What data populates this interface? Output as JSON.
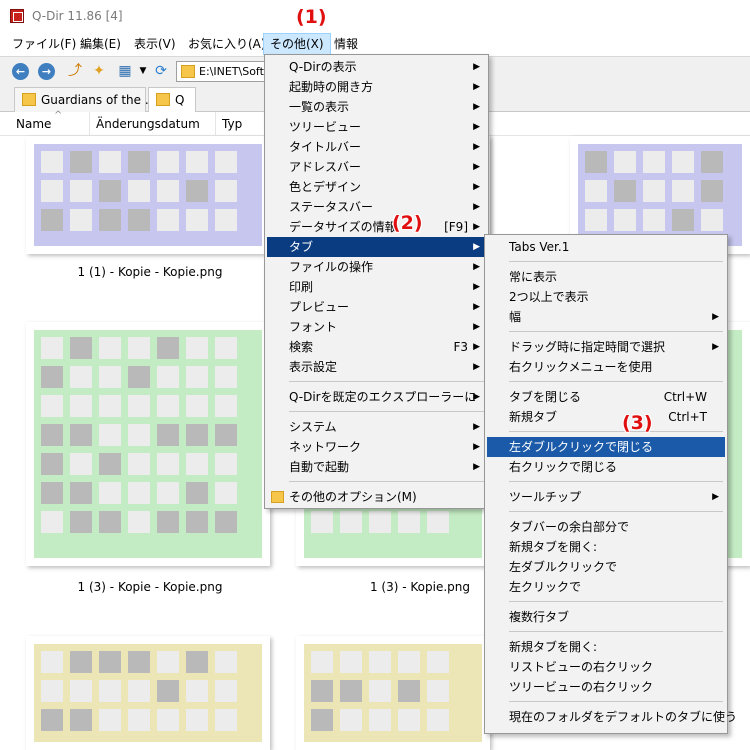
{
  "window": {
    "title": "Q-Dir 11.86 [4]"
  },
  "menubar": {
    "items": [
      "ファイル(F)",
      "編集(E)",
      "表示(V)",
      "お気に入り(A)",
      "その他(X)",
      "情報"
    ]
  },
  "toolbar": {
    "address": "E:\\INET\\Soft"
  },
  "tabs": [
    {
      "label": "Guardians of the ..."
    },
    {
      "label": "Q"
    }
  ],
  "columns": [
    "Name",
    "Änderungsdatum",
    "Typ"
  ],
  "thumbnails": [
    {
      "caption": "1 (1) - Kopie - Kopie.png"
    },
    {
      "caption": "1 (3) - Kopie - Kopie.png"
    },
    {
      "caption": "1 (3) - Kopie.png"
    }
  ],
  "colors": {
    "blue_tile": "#c6c6ee",
    "green_tile": "#c4ecc4",
    "yellow_tile": "#ece6b6",
    "gray_cell": "#b9b9b9",
    "light_cell": "#ececec",
    "menu_highlight": "#0a3c82"
  },
  "other_menu": {
    "items": [
      {
        "label": "Q-Dirの表示",
        "arrow": true
      },
      {
        "label": "起動時の開き方",
        "arrow": true
      },
      {
        "label": "一覧の表示",
        "arrow": true
      },
      {
        "label": "ツリービュー",
        "arrow": true
      },
      {
        "label": "タイトルバー",
        "arrow": true
      },
      {
        "label": "アドレスバー",
        "arrow": true
      },
      {
        "label": "色とデザイン",
        "arrow": true
      },
      {
        "label": "ステータスバー",
        "arrow": true
      },
      {
        "label": "データサイズの情報",
        "shortcut": "[F9]",
        "arrow": true
      },
      {
        "label": "タブ",
        "arrow": true,
        "highlight": true
      },
      {
        "label": "ファイルの操作",
        "arrow": true
      },
      {
        "label": "印刷",
        "arrow": true
      },
      {
        "label": "プレビュー",
        "arrow": true
      },
      {
        "label": "フォント",
        "arrow": true
      },
      {
        "label": "検索",
        "shortcut": "F3",
        "arrow": true
      },
      {
        "label": "表示設定",
        "arrow": true
      },
      {
        "label": "Q-Dirを既定のエクスプローラーに",
        "arrow": true
      },
      {
        "label": "システム",
        "arrow": true
      },
      {
        "label": "ネットワーク",
        "arrow": true
      },
      {
        "label": "自動で起動",
        "arrow": true
      },
      {
        "label": "その他のオプション(M)",
        "folder": true
      }
    ]
  },
  "tab_menu": {
    "items": [
      {
        "label": "Tabs Ver.1"
      },
      {
        "label": "常に表示"
      },
      {
        "label": "2つ以上で表示"
      },
      {
        "label": "幅",
        "arrow": true
      },
      {
        "label": "ドラッグ時に指定時間で選択",
        "arrow": true
      },
      {
        "label": "右クリックメニューを使用"
      },
      {
        "label": "タブを閉じる",
        "shortcut": "Ctrl+W"
      },
      {
        "label": "新規タブ",
        "shortcut": "Ctrl+T"
      },
      {
        "label": "左ダブルクリックで閉じる",
        "highlight": true
      },
      {
        "label": "右クリックで閉じる"
      },
      {
        "label": "ツールチップ",
        "arrow": true
      },
      {
        "label": "タブバーの余白部分で"
      },
      {
        "label": "新規タブを開く:"
      },
      {
        "label": "左ダブルクリックで"
      },
      {
        "label": "左クリックで"
      },
      {
        "label": "複数行タブ"
      },
      {
        "label": "新規タブを開く:"
      },
      {
        "label": "リストビューの右クリック"
      },
      {
        "label": "ツリービューの右クリック"
      },
      {
        "label": "現在のフォルダをデフォルトのタブに使う"
      }
    ]
  },
  "annotations": [
    "(1)",
    "(2)",
    "(3)"
  ]
}
